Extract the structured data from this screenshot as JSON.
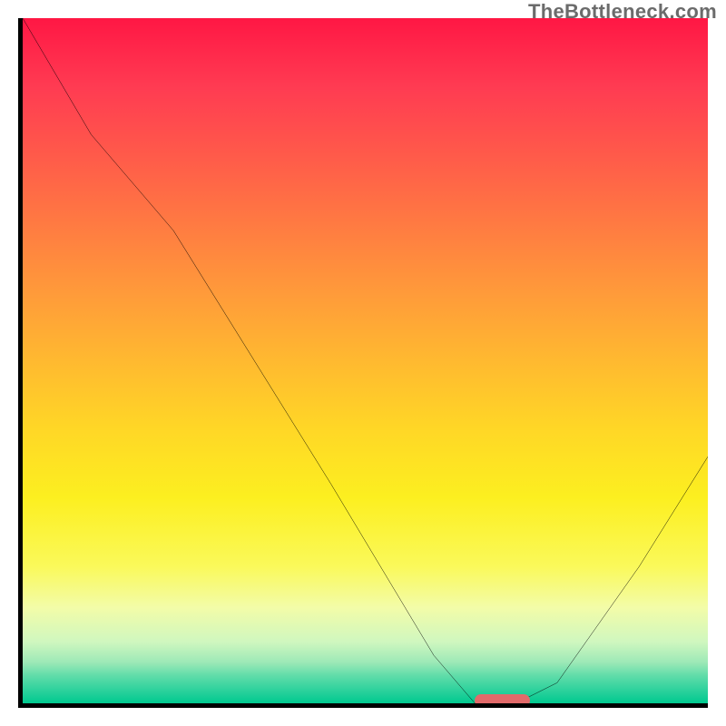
{
  "attribution": "TheBottleneck.com",
  "chart_data": {
    "type": "line",
    "title": "",
    "xlabel": "",
    "ylabel": "",
    "x_range": [
      0,
      100
    ],
    "y_range": [
      0,
      100
    ],
    "axes_visible": {
      "x": true,
      "y": true,
      "ticks": false,
      "labels": false
    },
    "gradient_background": {
      "direction": "vertical",
      "stops": [
        {
          "pct": 0,
          "color": "#ff1744"
        },
        {
          "pct": 50,
          "color": "#ffb930"
        },
        {
          "pct": 80,
          "color": "#faf95a"
        },
        {
          "pct": 100,
          "color": "#00c98f"
        }
      ]
    },
    "series": [
      {
        "name": "bottleneck-curve",
        "color": "#000000",
        "x": [
          0,
          10,
          22,
          45,
          60,
          66,
          72,
          78,
          90,
          100
        ],
        "y": [
          100,
          83,
          69,
          32,
          7,
          0,
          0,
          3,
          20,
          36
        ]
      }
    ],
    "marker": {
      "name": "optimal-range",
      "color": "#e26a6a",
      "x_start": 66,
      "x_end": 74,
      "y": 0
    }
  }
}
